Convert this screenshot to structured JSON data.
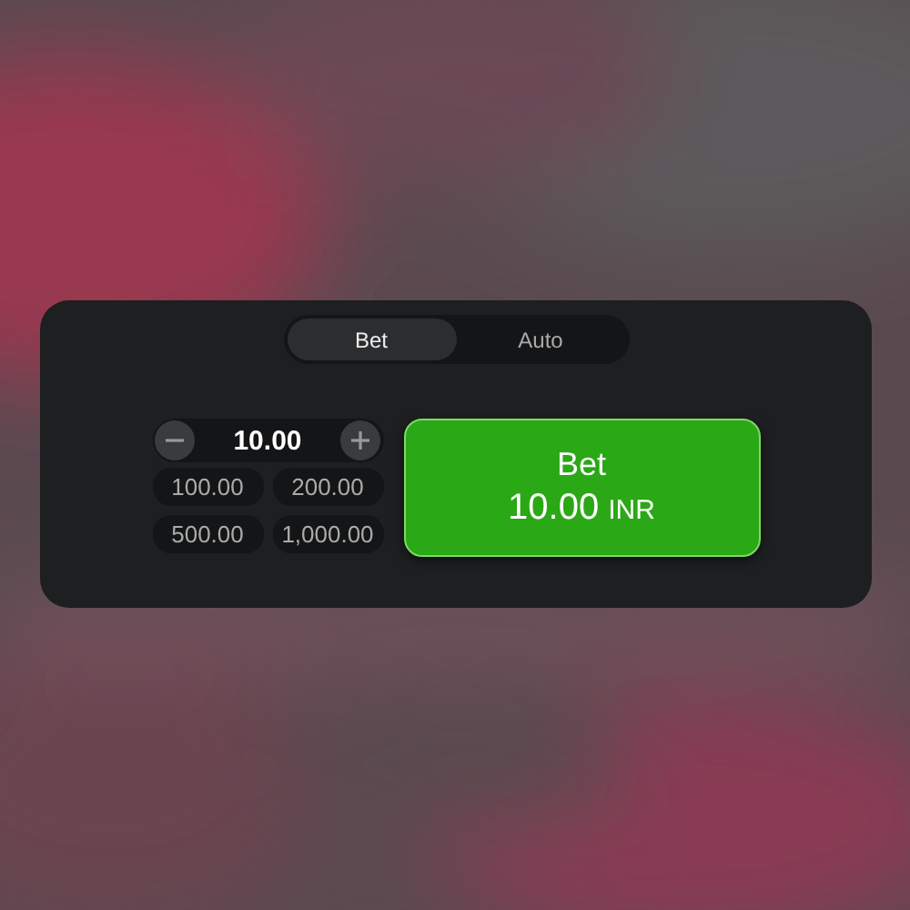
{
  "tabs": [
    {
      "label": "Bet",
      "selected": true
    },
    {
      "label": "Auto",
      "selected": false
    }
  ],
  "stake": {
    "value": "10.00"
  },
  "quick_amounts": [
    "100.00",
    "200.00",
    "500.00",
    "1,000.00"
  ],
  "bet_button": {
    "label": "Bet",
    "amount": "10.00",
    "currency": "INR"
  }
}
